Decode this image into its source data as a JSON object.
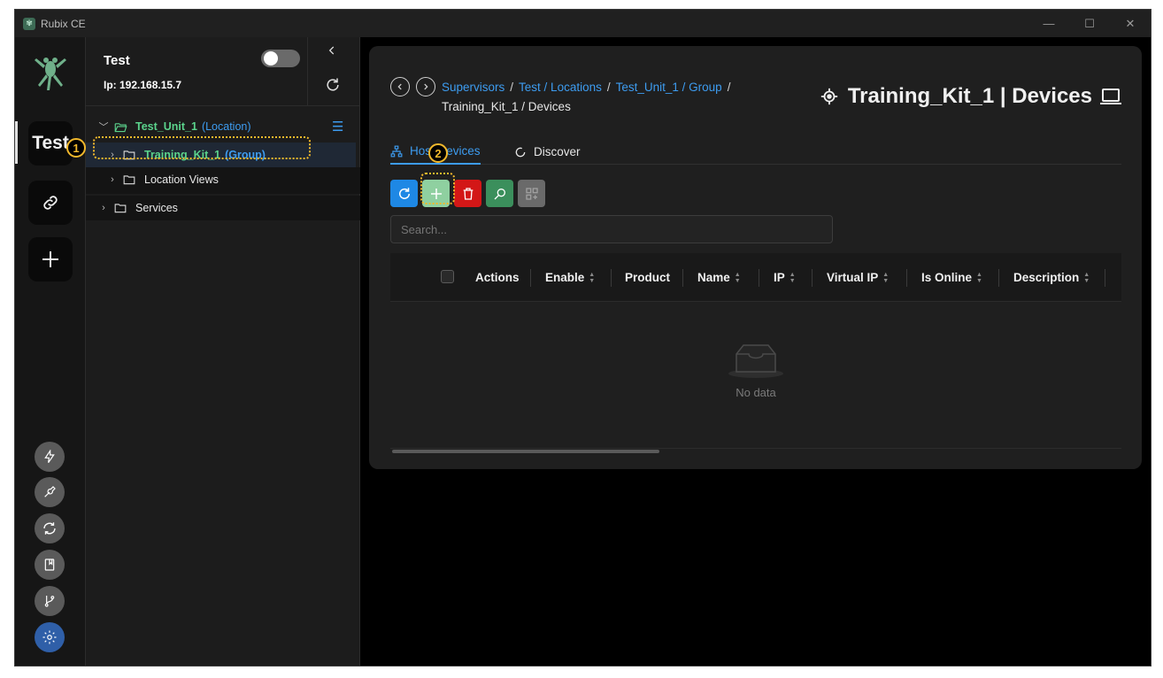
{
  "window": {
    "title": "Rubix CE",
    "minimize": "—",
    "maximize": "☐",
    "close": "✕"
  },
  "rail": {
    "active_label": "Test"
  },
  "host": {
    "name": "Test",
    "ip": "Ip: 192.168.15.7"
  },
  "tree": {
    "location": {
      "label": "Test_Unit_1",
      "tag": "(Location)"
    },
    "group": {
      "label": "Training_Kit_1",
      "tag": "(Group)"
    },
    "location_views": {
      "label": "Location Views"
    },
    "services": {
      "label": "Services"
    }
  },
  "annotations": {
    "one": "1",
    "two": "2"
  },
  "breadcrumb": {
    "items": [
      "Supervisors",
      "Test / Locations",
      "Test_Unit_1 / Group"
    ],
    "sep": "/",
    "current": "Training_Kit_1 / Devices"
  },
  "page_title": "Training_Kit_1 | Devices",
  "tabs": {
    "host_devices": "Host Devices",
    "discover": "Discover"
  },
  "search": {
    "placeholder": "Search..."
  },
  "table": {
    "columns": [
      "Actions",
      "Enable",
      "Product",
      "Name",
      "IP",
      "Virtual IP",
      "Is Online",
      "Description"
    ],
    "empty_text": "No data"
  },
  "colors": {
    "accent": "#3d9cf0",
    "green": "#5bd38c",
    "annotation": "#f2b92c",
    "delete": "#d31717"
  }
}
